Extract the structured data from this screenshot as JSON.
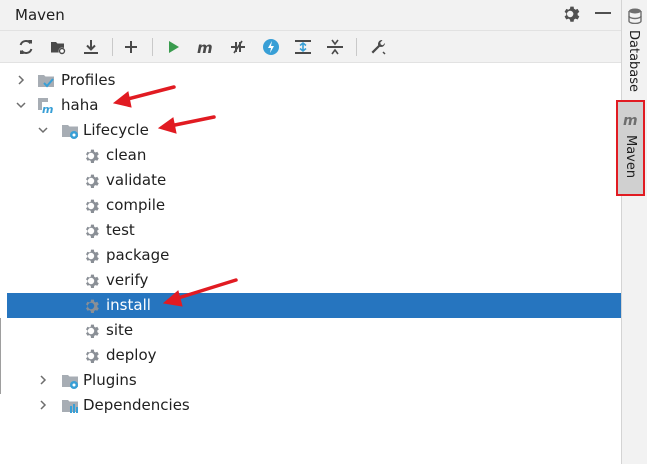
{
  "panel": {
    "title": "Maven"
  },
  "toolbar": {
    "buttons": [
      {
        "name": "reload-icon",
        "color": "#4a4a4a"
      },
      {
        "name": "reimport-folder-icon",
        "color": "#4a4a4a"
      },
      {
        "name": "download-icon",
        "color": "#4a4a4a"
      },
      {
        "name": "add-icon",
        "color": "#4a4a4a"
      },
      {
        "name": "run-icon",
        "color": "#3a9c4e"
      },
      {
        "name": "maven-goal-icon",
        "color": "#4a4a4a"
      },
      {
        "name": "toggle-offline-icon",
        "color": "#4a4a4a"
      },
      {
        "name": "skip-tests-icon",
        "color": "#389fd6"
      },
      {
        "name": "show-dependencies-icon",
        "color": "#389fd6"
      },
      {
        "name": "collapse-all-icon",
        "color": "#4a4a4a"
      },
      {
        "name": "settings-wrench-icon",
        "color": "#4a4a4a"
      }
    ]
  },
  "tree": {
    "profiles": "Profiles",
    "project": "haha",
    "lifecycle": "Lifecycle",
    "goals": [
      "clean",
      "validate",
      "compile",
      "test",
      "package",
      "verify",
      "install",
      "site",
      "deploy"
    ],
    "selected_goal": "install",
    "plugins": "Plugins",
    "dependencies": "Dependencies"
  },
  "sidebar": {
    "tabs": [
      "Database",
      "Maven"
    ]
  },
  "colors": {
    "selection": "#2675bf",
    "annotation": "#e11b22",
    "gear": "#8a8f96",
    "folder": "#a7adb4",
    "accent_blue": "#389fd6"
  }
}
